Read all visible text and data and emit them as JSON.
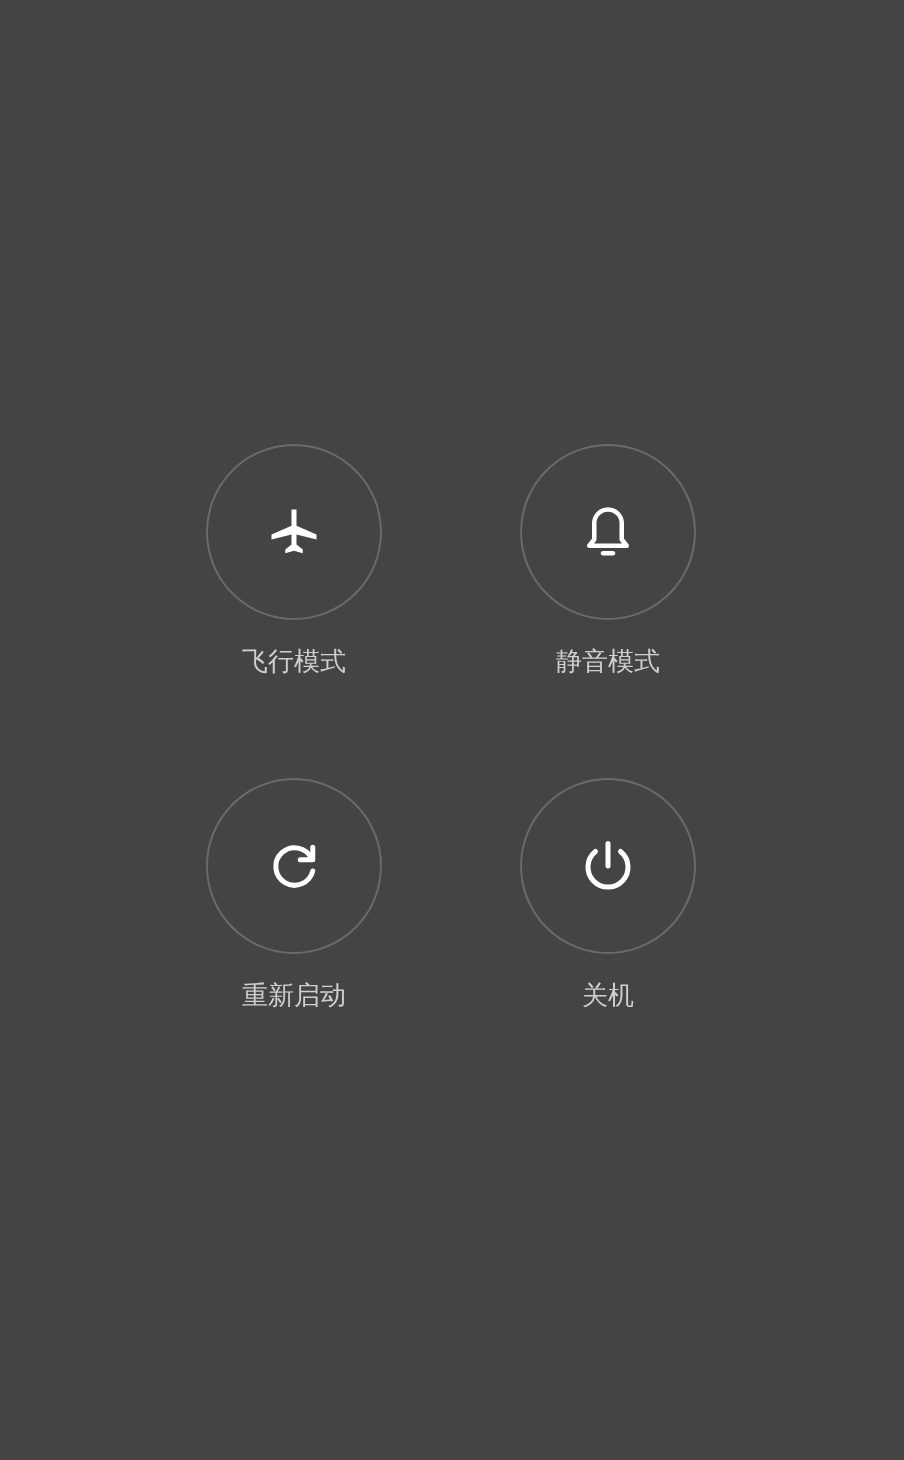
{
  "options": [
    {
      "kind": "airplane",
      "label": "飞行模式"
    },
    {
      "kind": "bell",
      "label": "静音模式"
    },
    {
      "kind": "restart",
      "label": "重新启动"
    },
    {
      "kind": "power",
      "label": "关机"
    }
  ]
}
